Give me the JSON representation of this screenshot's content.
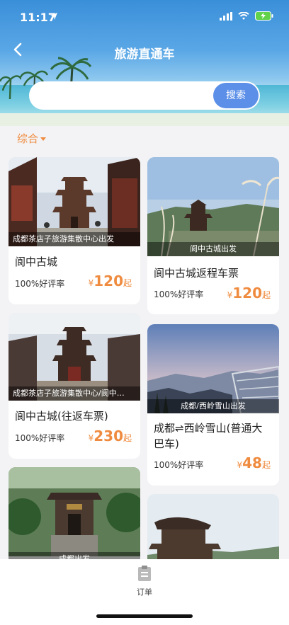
{
  "status": {
    "time": "11:17"
  },
  "nav": {
    "title": "旅游直通车"
  },
  "search": {
    "placeholder": "",
    "button": "搜索"
  },
  "sort": {
    "label": "综合"
  },
  "cards": [
    {
      "caption": "成都茶店子旅游集散中心出发",
      "name": "阆中古城",
      "rating": "100%好评率",
      "currency": "¥",
      "price": "120",
      "suffix": "起"
    },
    {
      "caption": "阆中古城出发",
      "name": "阆中古城返程车票",
      "rating": "100%好评率",
      "currency": "¥",
      "price": "120",
      "suffix": "起"
    },
    {
      "caption": "成都茶店子旅游集散中心/阆中…",
      "name": "阆中古城(往返车票)",
      "rating": "100%好评率",
      "currency": "¥",
      "price": "230",
      "suffix": "起"
    },
    {
      "caption": "成都/西岭雪山出发",
      "name": "成都⇌西岭雪山(普通大巴车)",
      "rating": "100%好评率",
      "currency": "¥",
      "price": "48",
      "suffix": "起"
    },
    {
      "caption": "成都出发"
    },
    {
      "caption": ""
    }
  ],
  "tabbar": {
    "orders": "订单"
  },
  "colors": {
    "accent": "#ef8b3f",
    "searchButton": "#5b8fe8"
  }
}
